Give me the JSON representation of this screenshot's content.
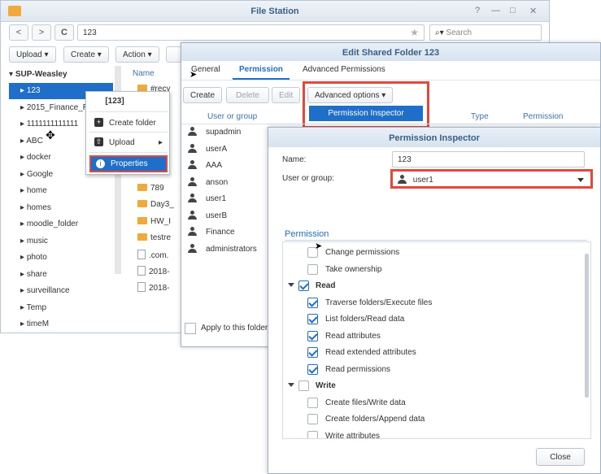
{
  "file_station": {
    "title": "File Station",
    "window_controls": [
      "?",
      "—",
      "□",
      "✕"
    ],
    "back": "<",
    "forward": ">",
    "refresh": "C",
    "path": "123",
    "search_placeholder": "Search",
    "toolbar": {
      "upload": "Upload",
      "create": "Create",
      "action": "Action"
    },
    "tree_root": "SUP-Weasley",
    "tree_items": [
      "123",
      "2015_Finance_R",
      "1111111111111",
      "ABC",
      "docker",
      "Google",
      "home",
      "homes",
      "moodle_folder",
      "music",
      "photo",
      "share",
      "surveillance",
      "Temp",
      "timeM"
    ],
    "list_header": "Name",
    "files": [
      {
        "name": "#recy",
        "kind": "folder"
      },
      {
        "name": "789",
        "kind": "folder"
      },
      {
        "name": "Day3_",
        "kind": "folder"
      },
      {
        "name": "HW_I",
        "kind": "folder"
      },
      {
        "name": "testre",
        "kind": "folder"
      },
      {
        "name": ".com.",
        "kind": "doc"
      },
      {
        "name": "2018-",
        "kind": "doc"
      },
      {
        "name": "2018-",
        "kind": "doc"
      }
    ]
  },
  "context_menu": {
    "title": "[123]",
    "items": [
      {
        "label": "Create folder",
        "icon": "plus-icon"
      },
      {
        "label": "Upload",
        "icon": "upload-icon"
      },
      {
        "label": "Properties",
        "icon": "info-icon"
      }
    ]
  },
  "edit_shared_folder": {
    "title": "Edit Shared Folder 123",
    "tabs": [
      "General",
      "Permission",
      "Advanced Permissions"
    ],
    "buttons": {
      "create": "Create",
      "delete": "Delete",
      "edit": "Edit",
      "advanced_options": "Advanced options"
    },
    "dropdown_item": "Permission Inspector",
    "columns": {
      "user": "User or group",
      "type": "Type",
      "permission": "Permission"
    },
    "users": [
      "supadmin",
      "userA",
      "AAA",
      "anson",
      "user1",
      "userB",
      "Finance",
      "administrators"
    ],
    "apply_label": "Apply to this folder"
  },
  "permission_inspector": {
    "title": "Permission Inspector",
    "name_label": "Name:",
    "name_value": "123",
    "user_label": "User or group:",
    "user_value": "user1",
    "permission_heading": "Permission",
    "permissions": [
      {
        "label": "Change permissions",
        "checked": false,
        "level": 1
      },
      {
        "label": "Take ownership",
        "checked": false,
        "level": 1
      },
      {
        "label": "Read",
        "checked": true,
        "level": 0
      },
      {
        "label": "Traverse folders/Execute files",
        "checked": true,
        "level": 1
      },
      {
        "label": "List folders/Read data",
        "checked": true,
        "level": 1
      },
      {
        "label": "Read attributes",
        "checked": true,
        "level": 1
      },
      {
        "label": "Read extended attributes",
        "checked": true,
        "level": 1
      },
      {
        "label": "Read permissions",
        "checked": true,
        "level": 1
      },
      {
        "label": "Write",
        "checked": false,
        "level": 0
      },
      {
        "label": "Create files/Write data",
        "checked": false,
        "level": 1
      },
      {
        "label": "Create folders/Append data",
        "checked": false,
        "level": 1
      },
      {
        "label": "Write attributes",
        "checked": false,
        "level": 1
      }
    ],
    "close": "Close"
  },
  "colors": {
    "accent": "#1f6fca",
    "highlight_border": "#e5473b",
    "folder": "#f0a93b"
  }
}
